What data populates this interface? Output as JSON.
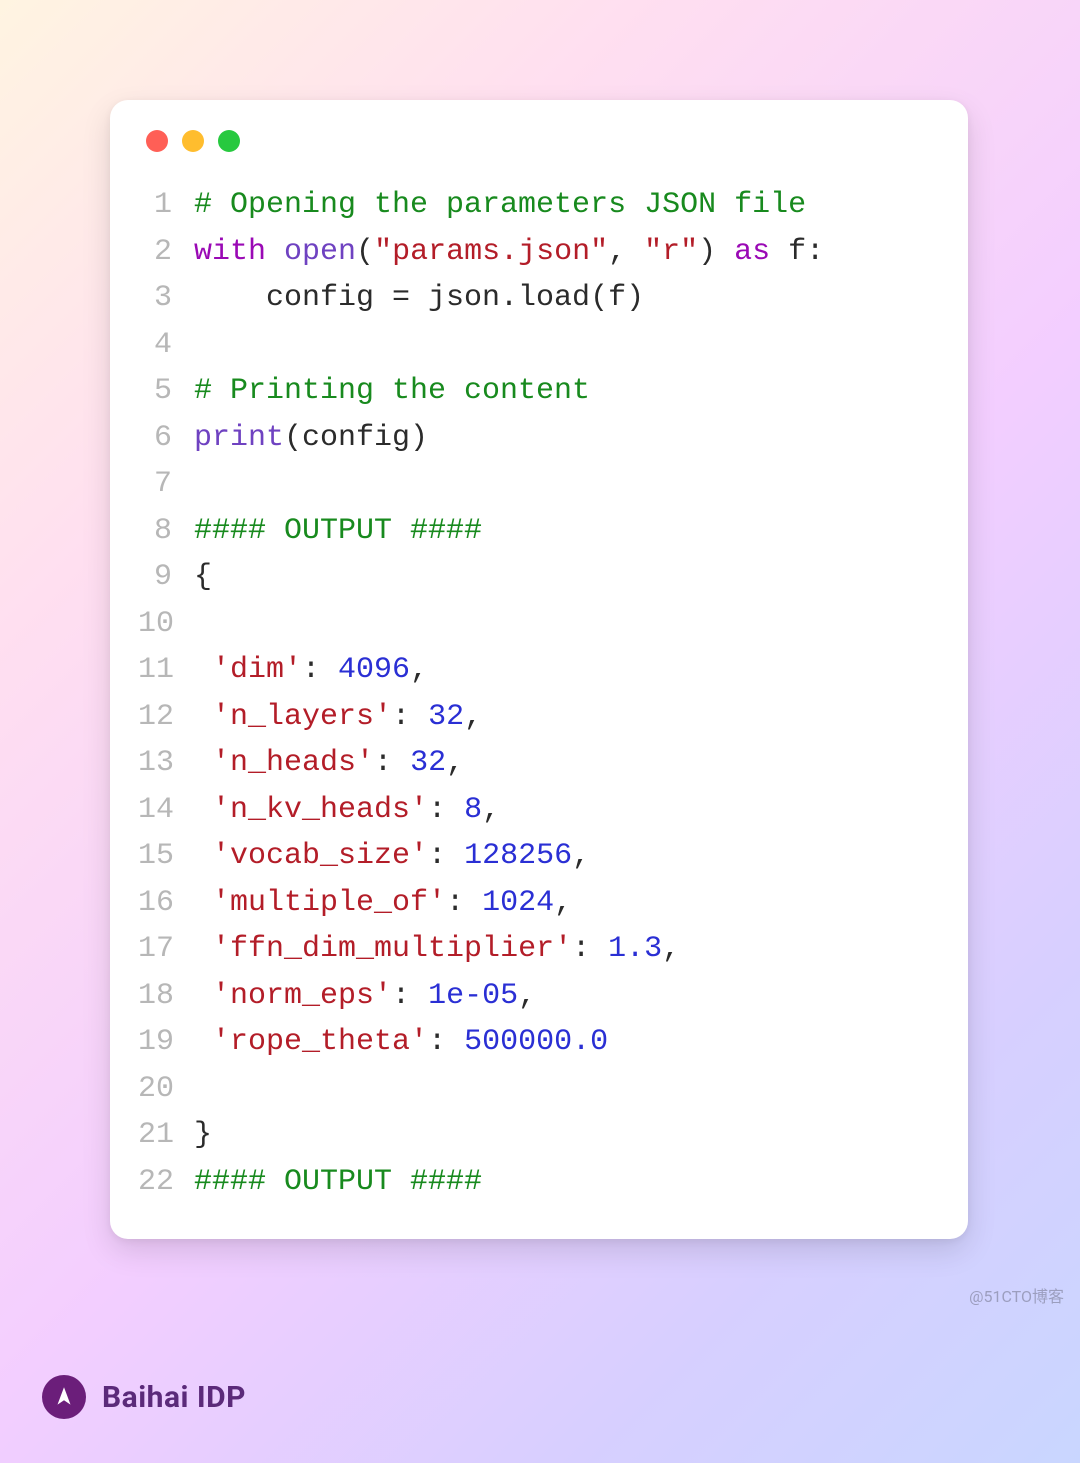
{
  "brand": {
    "name": "Baihai IDP"
  },
  "watermark": "@51CTO博客",
  "colors": {
    "comment": "#188a1e",
    "keyword": "#9a09b5",
    "builtin": "#6f42c1",
    "string": "#b31d28",
    "number": "#2a2fd4",
    "default": "#2b2b2b",
    "dot_red": "#ff5f56",
    "dot_yellow": "#ffbd2e",
    "dot_green": "#27c93f"
  },
  "lines": [
    {
      "n": 1,
      "tokens": [
        {
          "t": "# Opening the parameters JSON file",
          "c": "comment"
        }
      ]
    },
    {
      "n": 2,
      "tokens": [
        {
          "t": "with",
          "c": "keyword"
        },
        {
          "t": " ",
          "c": "default"
        },
        {
          "t": "open",
          "c": "builtin"
        },
        {
          "t": "(",
          "c": "default"
        },
        {
          "t": "\"params.json\"",
          "c": "string"
        },
        {
          "t": ", ",
          "c": "default"
        },
        {
          "t": "\"r\"",
          "c": "string"
        },
        {
          "t": ") ",
          "c": "default"
        },
        {
          "t": "as",
          "c": "keyword"
        },
        {
          "t": " f:",
          "c": "default"
        }
      ]
    },
    {
      "n": 3,
      "tokens": [
        {
          "t": "    config = json.load(f)",
          "c": "default"
        }
      ]
    },
    {
      "n": 4,
      "tokens": [
        {
          "t": "",
          "c": "default"
        }
      ]
    },
    {
      "n": 5,
      "tokens": [
        {
          "t": "# Printing the content",
          "c": "comment"
        }
      ]
    },
    {
      "n": 6,
      "tokens": [
        {
          "t": "print",
          "c": "builtin"
        },
        {
          "t": "(config)",
          "c": "default"
        }
      ]
    },
    {
      "n": 7,
      "tokens": [
        {
          "t": "",
          "c": "default"
        }
      ]
    },
    {
      "n": 8,
      "tokens": [
        {
          "t": "#### OUTPUT ####",
          "c": "comment"
        }
      ]
    },
    {
      "n": 9,
      "tokens": [
        {
          "t": "{",
          "c": "default"
        }
      ]
    },
    {
      "n": 10,
      "tokens": [
        {
          "t": "",
          "c": "default"
        }
      ]
    },
    {
      "n": 11,
      "tokens": [
        {
          "t": " ",
          "c": "default"
        },
        {
          "t": "'dim'",
          "c": "string"
        },
        {
          "t": ": ",
          "c": "default"
        },
        {
          "t": "4096",
          "c": "number"
        },
        {
          "t": ",",
          "c": "default"
        }
      ]
    },
    {
      "n": 12,
      "tokens": [
        {
          "t": " ",
          "c": "default"
        },
        {
          "t": "'n_layers'",
          "c": "string"
        },
        {
          "t": ": ",
          "c": "default"
        },
        {
          "t": "32",
          "c": "number"
        },
        {
          "t": ",",
          "c": "default"
        }
      ]
    },
    {
      "n": 13,
      "tokens": [
        {
          "t": " ",
          "c": "default"
        },
        {
          "t": "'n_heads'",
          "c": "string"
        },
        {
          "t": ": ",
          "c": "default"
        },
        {
          "t": "32",
          "c": "number"
        },
        {
          "t": ",",
          "c": "default"
        }
      ]
    },
    {
      "n": 14,
      "tokens": [
        {
          "t": " ",
          "c": "default"
        },
        {
          "t": "'n_kv_heads'",
          "c": "string"
        },
        {
          "t": ": ",
          "c": "default"
        },
        {
          "t": "8",
          "c": "number"
        },
        {
          "t": ",",
          "c": "default"
        }
      ]
    },
    {
      "n": 15,
      "tokens": [
        {
          "t": " ",
          "c": "default"
        },
        {
          "t": "'vocab_size'",
          "c": "string"
        },
        {
          "t": ": ",
          "c": "default"
        },
        {
          "t": "128256",
          "c": "number"
        },
        {
          "t": ",",
          "c": "default"
        }
      ]
    },
    {
      "n": 16,
      "tokens": [
        {
          "t": " ",
          "c": "default"
        },
        {
          "t": "'multiple_of'",
          "c": "string"
        },
        {
          "t": ": ",
          "c": "default"
        },
        {
          "t": "1024",
          "c": "number"
        },
        {
          "t": ",",
          "c": "default"
        }
      ]
    },
    {
      "n": 17,
      "tokens": [
        {
          "t": " ",
          "c": "default"
        },
        {
          "t": "'ffn_dim_multiplier'",
          "c": "string"
        },
        {
          "t": ": ",
          "c": "default"
        },
        {
          "t": "1.3",
          "c": "number"
        },
        {
          "t": ",",
          "c": "default"
        }
      ]
    },
    {
      "n": 18,
      "tokens": [
        {
          "t": " ",
          "c": "default"
        },
        {
          "t": "'norm_eps'",
          "c": "string"
        },
        {
          "t": ": ",
          "c": "default"
        },
        {
          "t": "1e-05",
          "c": "number"
        },
        {
          "t": ",",
          "c": "default"
        }
      ]
    },
    {
      "n": 19,
      "tokens": [
        {
          "t": " ",
          "c": "default"
        },
        {
          "t": "'rope_theta'",
          "c": "string"
        },
        {
          "t": ": ",
          "c": "default"
        },
        {
          "t": "500000.0",
          "c": "number"
        }
      ]
    },
    {
      "n": 20,
      "tokens": [
        {
          "t": "",
          "c": "default"
        }
      ]
    },
    {
      "n": 21,
      "tokens": [
        {
          "t": "}",
          "c": "default"
        }
      ]
    },
    {
      "n": 22,
      "tokens": [
        {
          "t": "#### OUTPUT ####",
          "c": "comment"
        }
      ]
    }
  ]
}
